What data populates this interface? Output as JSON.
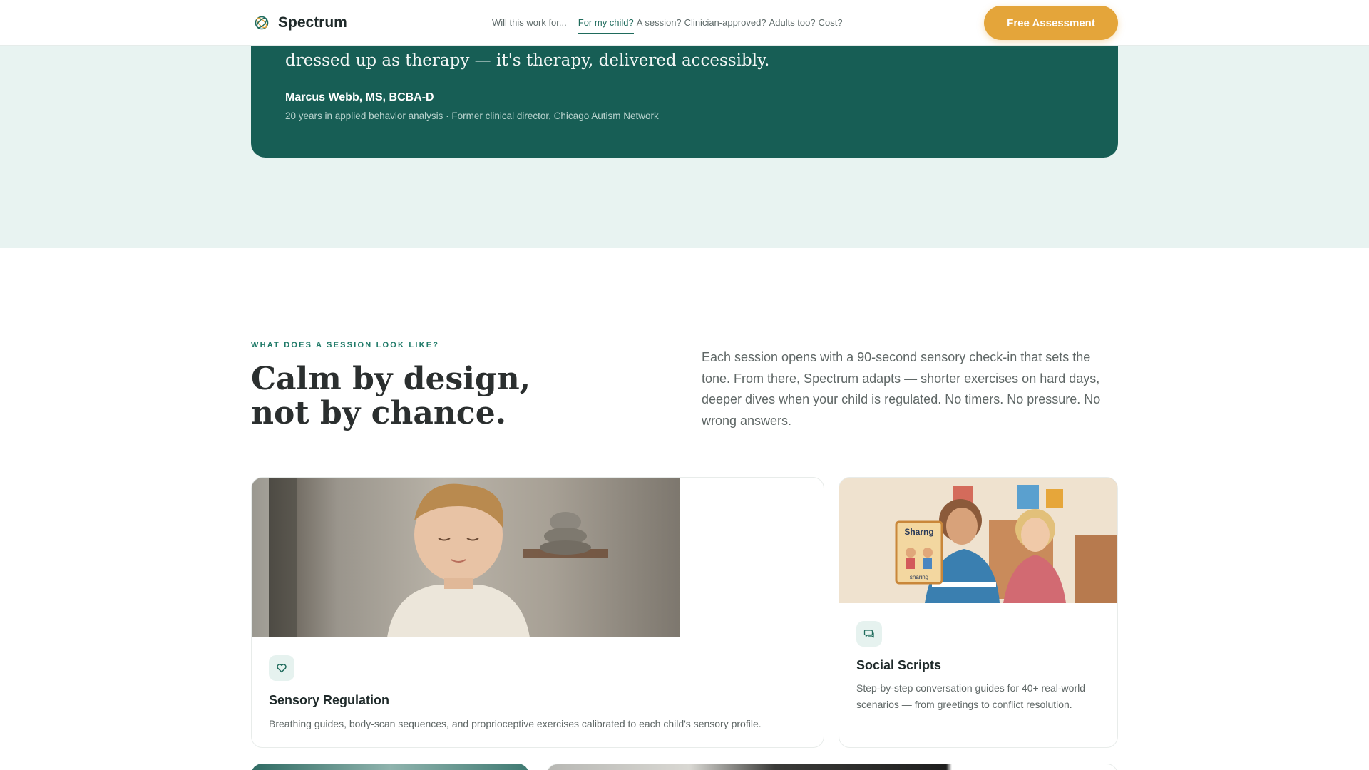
{
  "header": {
    "brand": "Spectrum",
    "nav_lead": "Will this work for...",
    "nav_items": [
      "For my child?",
      "A session?",
      "Clinician-approved?",
      "Adults too?",
      "Cost?"
    ],
    "cta_label": "Free Assessment"
  },
  "testimonial": {
    "quote_tail": "dressed up as therapy — it's therapy, delivered accessibly.",
    "author_name": "Marcus Webb, MS, BCBA-D",
    "author_meta": "20 years in applied behavior analysis · Former clinical director, Chicago Autism Network"
  },
  "session": {
    "eyebrow": "WHAT DOES A SESSION LOOK LIKE?",
    "headline_line1": "Calm by design,",
    "headline_line2": "not by chance.",
    "intro": "Each session opens with a 90-second sensory check-in that sets the tone. From there, Spectrum adapts — shorter exercises on hard days, deeper dives when your child is regulated. No timers. No pressure. No wrong answers."
  },
  "cards": [
    {
      "icon": "heart-icon",
      "title": "Sensory Regulation",
      "description": "Breathing guides, body-scan sequences, and proprioceptive exercises calibrated to each child's sensory profile."
    },
    {
      "icon": "chat-bubbles-icon",
      "title": "Social Scripts",
      "description": "Step-by-step conversation guides for 40+ real-world scenarios — from greetings to conflict resolution.",
      "photo_card_text_top": "Sharng",
      "photo_card_text_bottom": "sharing"
    }
  ],
  "colors": {
    "brand_green": "#175e55",
    "accent_orange": "#e4a53a",
    "band_bg": "#e8f3f1"
  }
}
